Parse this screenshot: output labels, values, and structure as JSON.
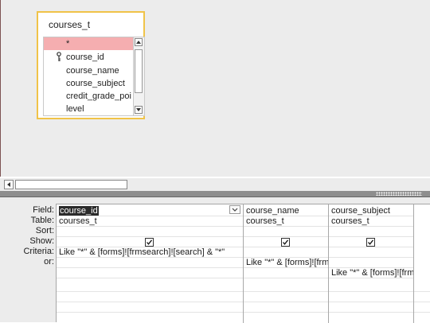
{
  "table": {
    "name": "courses_t",
    "fields": [
      "*",
      "course_id",
      "course_name",
      "course_subject",
      "credit_grade_poi",
      "level"
    ]
  },
  "grid": {
    "row_labels": [
      "Field:",
      "Table:",
      "Sort:",
      "Show:",
      "Criteria:",
      "or:"
    ],
    "columns": [
      {
        "field": "course_id",
        "table": "courses_t",
        "sort": "",
        "show": true,
        "criteria": "Like \"*\" & [forms]![frmsearch]![search] & \"*\"",
        "or": "",
        "or2": ""
      },
      {
        "field": "course_name",
        "table": "courses_t",
        "sort": "",
        "show": true,
        "criteria": "",
        "or": "Like \"*\" & [forms]![frm",
        "or2": ""
      },
      {
        "field": "course_subject",
        "table": "courses_t",
        "sort": "",
        "show": true,
        "criteria": "",
        "or": "",
        "or2": "Like \"*\" & [forms]![frm"
      }
    ]
  },
  "colors": {
    "table_border": "#f0c348",
    "selected_field": "#f5aeb0",
    "splitter": "#8e8e8e"
  },
  "icons": [
    "key-icon",
    "scroll-up-icon",
    "scroll-down-icon",
    "scroll-left-icon",
    "dropdown-arrow-icon",
    "checkbox-checked-icon"
  ]
}
